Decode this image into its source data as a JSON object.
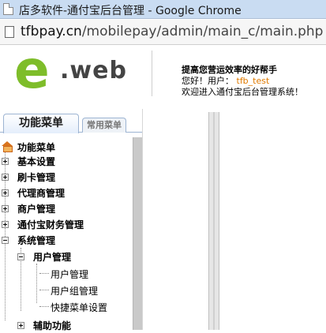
{
  "browser": {
    "window_title": "店多软件-通付宝后台管理 - Google Chrome",
    "url_host": "tfbpay.cn",
    "url_path": "/mobilepay/admin/main_c/main.php"
  },
  "header": {
    "logo_e": "e",
    "logo_web": ".web",
    "slogan": "提高您营运效率的好帮手",
    "greeting_prefix": "您好！用户：",
    "username": "tfb_test",
    "welcome": "欢迎进入通付宝后台管理系统！"
  },
  "tabs": {
    "active": "功能菜单",
    "inactive": "常用菜单"
  },
  "tree": {
    "root": "功能菜单",
    "items": [
      "基本设置",
      "刷卡管理",
      "代理商管理",
      "商户管理",
      "通付宝财务管理",
      "系统管理"
    ],
    "sub_group": "用户管理",
    "sub_items": [
      "用户管理",
      "用户组管理",
      "快捷菜单设置"
    ],
    "next_group": "辅助功能"
  }
}
